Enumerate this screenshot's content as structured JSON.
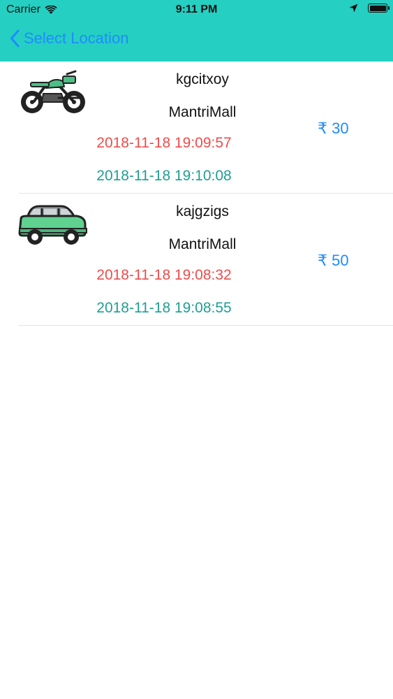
{
  "status_bar": {
    "carrier": "Carrier",
    "time": "9:11 PM"
  },
  "nav": {
    "back_label": "Select Location"
  },
  "colors": {
    "header_bg": "#25cfc1",
    "accent_blue": "#1f8bff",
    "in_time_red": "#ef4b4b",
    "out_time_teal": "#1f9e93"
  },
  "entries": [
    {
      "vehicle_icon": "motorcycle-icon",
      "vehicle_number": "kgcitxoy",
      "location": "MantriMall",
      "in_time": "2018-11-18 19:09:57",
      "out_time": "2018-11-18 19:10:08",
      "amount": "₹ 30"
    },
    {
      "vehicle_icon": "car-icon",
      "vehicle_number": "kajgzigs",
      "location": "MantriMall",
      "in_time": "2018-11-18 19:08:32",
      "out_time": "2018-11-18 19:08:55",
      "amount": "₹ 50"
    }
  ]
}
